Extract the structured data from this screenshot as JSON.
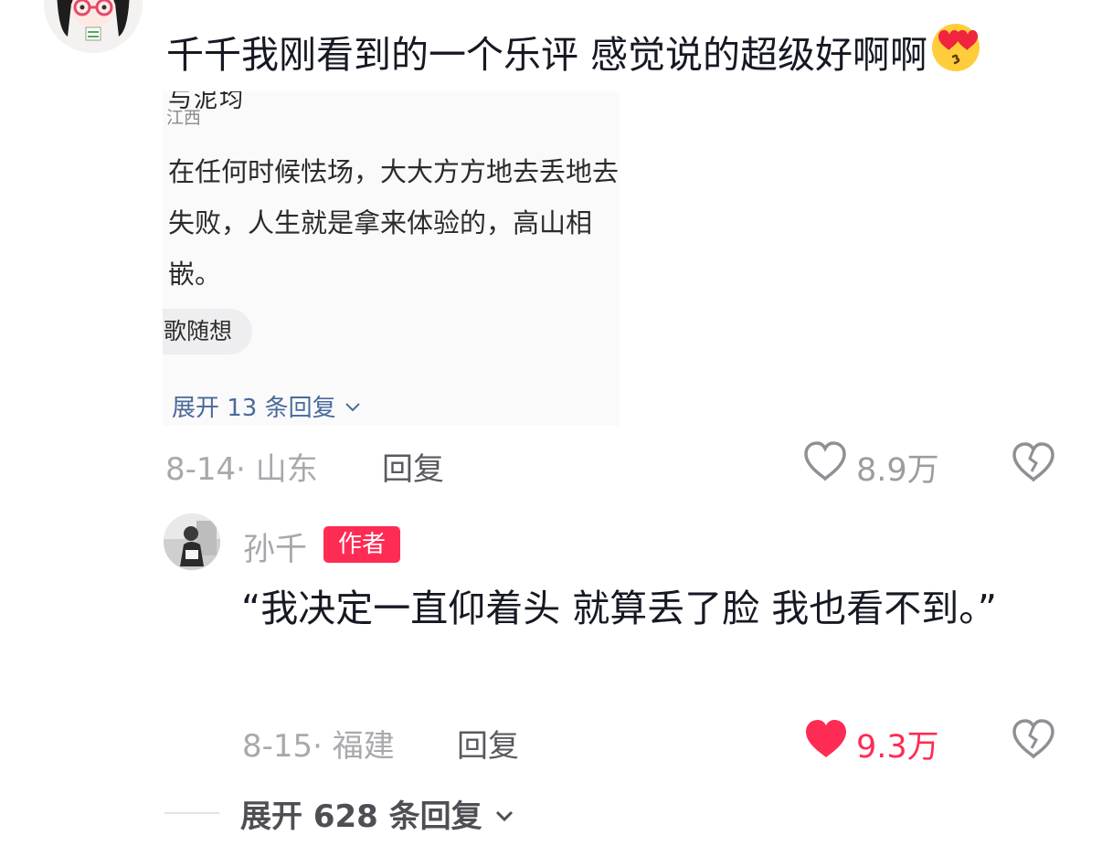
{
  "top_comment": {
    "text": "千千我刚看到的一个乐评 感觉说的超级好啊啊",
    "emoji": "smiling-face-with-heart-eyes",
    "date_location": "8-14· 山东",
    "reply_label": "回复",
    "like_count": "8.9万",
    "liked": false
  },
  "embedded_screenshot": {
    "cut_text": "与泥均",
    "location": "江西",
    "body": "在任何时候怯场，大大方方地去丢地去失败，人生就是拿来体验的，高山相嵌。",
    "tag": "歌随想",
    "expand_label": "展开 13 条回复"
  },
  "reply": {
    "author": "孙千",
    "badge": "作者",
    "text": "“我决定一直仰着头 就算丢了脸 我也看不到。”",
    "date_location": "8-15· 福建",
    "reply_label": "回复",
    "like_count": "9.3万",
    "liked": true
  },
  "expand_all_label": "展开 628 条回复",
  "colors": {
    "accent_red": "#fe2c55",
    "meta_gray": "#a8a9ad",
    "link_blue": "#4a6a9c"
  }
}
